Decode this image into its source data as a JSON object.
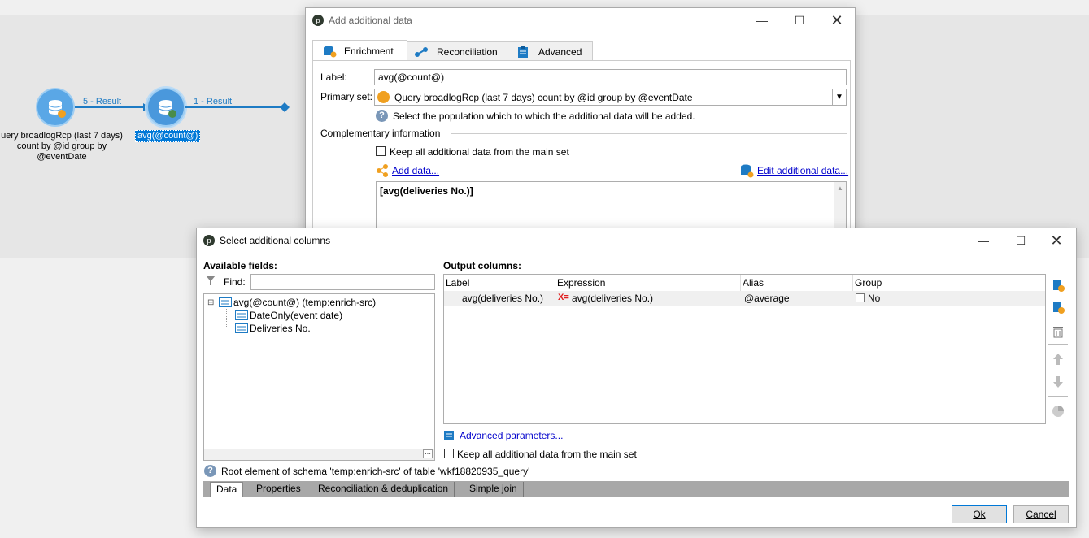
{
  "workflow": {
    "node1_label": "uery broadlogRcp (last 7 days)\ncount by @id group by\n@eventDate",
    "node1_label_lines": [
      "uery broadlogRcp (last 7 days)",
      "count by @id group by",
      "@eventDate"
    ],
    "transition1": "5 - Result",
    "node2_label": "avg(@count@)",
    "transition2": "1 - Result"
  },
  "add_dialog": {
    "title": "Add additional data",
    "tabs": [
      {
        "label": "Enrichment",
        "icon": "database-enrich-icon"
      },
      {
        "label": "Reconciliation",
        "icon": "link-icon"
      },
      {
        "label": "Advanced",
        "icon": "clipboard-icon"
      }
    ],
    "label_caption": "Label:",
    "label_value": "avg(@count@)",
    "primary_set_caption": "Primary set:",
    "primary_set_value": "Query broadlogRcp (last 7 days) count by @id group by @eventDate",
    "primary_set_help": "Select the population which to which the additional data will be added.",
    "complementary_caption": "Complementary information",
    "keep_all_label": "Keep all additional data from the main set",
    "add_data_link": "Add data...",
    "edit_data_link": "Edit additional data...",
    "data_list_item": "[avg(deliveries No.)]"
  },
  "columns_dialog": {
    "title": "Select additional columns",
    "available_caption": "Available fields:",
    "find_label": "Find:",
    "find_value": "",
    "tree": [
      {
        "label": "avg(@count@) (temp:enrich-src)",
        "level": 0,
        "expander": "⊟"
      },
      {
        "label": "DateOnly(event date)",
        "level": 1
      },
      {
        "label": "Deliveries No.",
        "level": 1
      }
    ],
    "output_caption": "Output columns:",
    "headers": [
      "Label",
      "Expression",
      "Alias",
      "Group"
    ],
    "rows": [
      {
        "label": "avg(deliveries No.)",
        "expression": "avg(deliveries No.)",
        "alias": "@average",
        "group": "No"
      }
    ],
    "advanced_link": "Advanced parameters...",
    "keep_all_label": "Keep all additional data from the main set",
    "status_text": "Root element of schema 'temp:enrich-src' of table 'wkf18820935_query'",
    "bottom_tabs": [
      "Data",
      "Properties",
      "Reconciliation & deduplication",
      "Simple join"
    ],
    "ok_label": "Ok",
    "cancel_label": "Cancel"
  },
  "colors": {
    "accent": "#1e7bc4",
    "node_fill": "#5aa7e6",
    "orange": "#f0a020",
    "selection": "#0078d7",
    "tabbar": "#a8a8a8"
  }
}
